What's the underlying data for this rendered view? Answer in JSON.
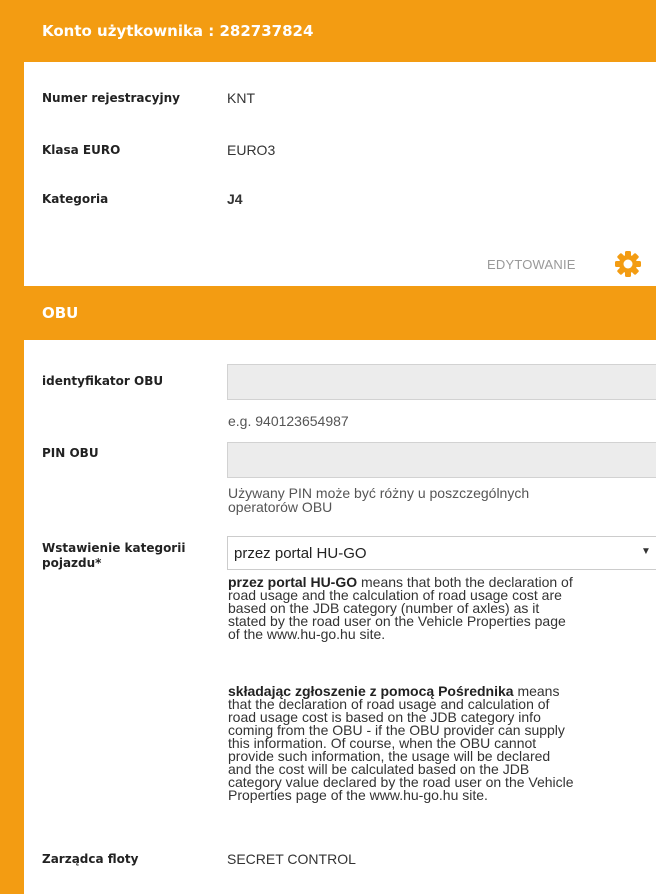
{
  "account": {
    "title": "Konto użytkownika : 282737824",
    "rows": [
      {
        "label": "Numer rejestracyjny",
        "value": "KNT"
      },
      {
        "label": "Klasa EURO",
        "value": "EURO3"
      },
      {
        "label": "Kategoria",
        "value": "J4"
      }
    ],
    "edit_label": "EDYTOWANIE",
    "edit_icon": "gear-icon"
  },
  "obu": {
    "title": "OBU",
    "id_label": "identyfikator OBU",
    "id_value": "",
    "id_hint": "e.g. 940123654987",
    "pin_label": "PIN OBU",
    "pin_value": "",
    "pin_hint_1": "Używany PIN może być różny u poszczególnych",
    "pin_hint_2": "operatorów OBU",
    "category_label_1": "Wstawienie kategorii",
    "category_label_2": "pojazdu*",
    "category_selected": "przez portal HU-GO",
    "desc1_bold": "przez portal HU-GO",
    "desc1_lines": [
      " means that both the declaration of",
      "road usage and the calculation of road usage cost are",
      "based on the JDB category (number of axles) as it",
      "stated by the road user on the Vehicle Properties page",
      "of the www.hu-go.hu site."
    ],
    "desc2_bold": "składając zgłoszenie z pomocą Pośrednika",
    "desc2_lines": [
      " means",
      "that the declaration of road usage and calculation of",
      "road usage cost is based on the JDB category info",
      "coming from the OBU - if the OBU provider can supply",
      "this information. Of course, when the OBU cannot",
      "provide such information, the usage will be declared",
      "and the cost will be calculated based on the JDB",
      "category value declared by the road user on the Vehicle",
      "Properties page of the www.hu-go.hu site."
    ],
    "fleet_label": "Zarządca floty",
    "fleet_value": "SECRET CONTROL"
  },
  "colors": {
    "accent": "#f39c12",
    "input_bg": "#ececec"
  }
}
